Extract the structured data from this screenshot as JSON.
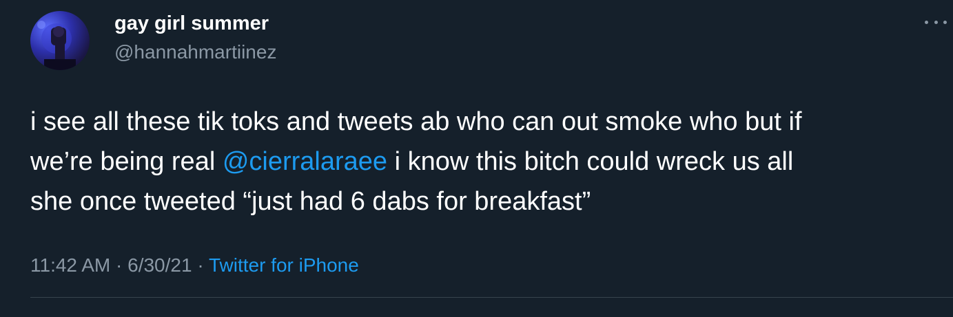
{
  "user": {
    "display_name": "gay girl summer",
    "handle": "@hannahmartiinez"
  },
  "tweet": {
    "line1": "i see all these tik toks and tweets ab who can out smoke who but if",
    "line2_before": "we’re being real ",
    "mention": "@cierralaraee",
    "line2_after": " i know this bitch could wreck us all",
    "line3": "she once tweeted “just had 6 dabs for breakfast”"
  },
  "meta": {
    "time": "11:42 AM",
    "sep1": " · ",
    "date": "6/30/21",
    "sep2": " · ",
    "source": "Twitter for iPhone"
  },
  "icons": {
    "more": "more-options-icon",
    "avatar": "avatar"
  },
  "colors": {
    "background": "#15202b",
    "text": "#ffffff",
    "secondary": "#8b98a5",
    "link": "#1d9bf0",
    "divider": "#38444d"
  }
}
